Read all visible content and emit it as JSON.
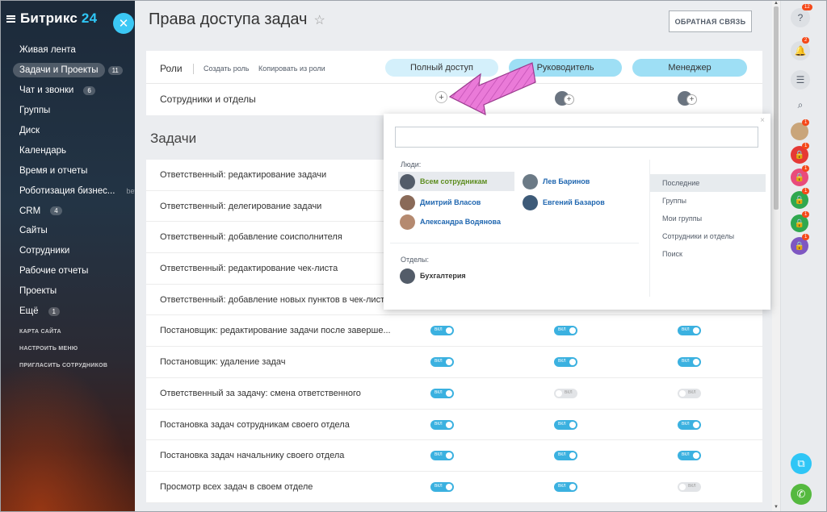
{
  "sidebar": {
    "logo_name": "Битрикс",
    "logo_num": "24",
    "items": [
      {
        "label": "Живая лента",
        "count": ""
      },
      {
        "label": "Задачи и Проекты",
        "count": "11"
      },
      {
        "label": "Чат и звонки",
        "count": "6"
      },
      {
        "label": "Группы",
        "count": ""
      },
      {
        "label": "Диск",
        "count": ""
      },
      {
        "label": "Календарь",
        "count": ""
      },
      {
        "label": "Время и отчеты",
        "count": ""
      },
      {
        "label": "Роботизация бизнес...",
        "count": "",
        "beta": "beta"
      },
      {
        "label": "CRM",
        "count": "4"
      },
      {
        "label": "Сайты",
        "count": ""
      },
      {
        "label": "Сотрудники",
        "count": ""
      },
      {
        "label": "Рабочие отчеты",
        "count": ""
      },
      {
        "label": "Проекты",
        "count": ""
      },
      {
        "label": "Ещё",
        "count": "1"
      }
    ],
    "links": [
      "КАРТА САЙТА",
      "НАСТРОИТЬ МЕНЮ",
      "ПРИГЛАСИТЬ СОТРУДНИКОВ"
    ]
  },
  "page": {
    "title": "Права доступа задач",
    "feedback": "ОБРАТНАЯ СВЯЗЬ"
  },
  "roles": {
    "label": "Роли",
    "create": "Создать роль",
    "copy": "Копировать из роли",
    "role_names": [
      "Полный доступ",
      "Руководитель",
      "Менеджер"
    ],
    "staff_label": "Сотрудники и отделы",
    "plus": "+"
  },
  "tasks": {
    "section_title": "Задачи",
    "toggle_text": "ВКЛ",
    "rows": [
      {
        "label": "Ответственный: редактирование задачи",
        "states": [
          true,
          true,
          true
        ]
      },
      {
        "label": "Ответственный: делегирование задачи",
        "states": [
          true,
          true,
          true
        ]
      },
      {
        "label": "Ответственный: добавление соисполнителя",
        "states": [
          true,
          true,
          true
        ]
      },
      {
        "label": "Ответственный: редактирование чек-листа",
        "states": [
          true,
          true,
          true
        ]
      },
      {
        "label": "Ответственный: добавление новых пунктов в чек-листы",
        "states": [
          true,
          true,
          true
        ]
      },
      {
        "label": "Постановщик: редактирование задачи после заверше...",
        "states": [
          true,
          true,
          true
        ]
      },
      {
        "label": "Постановщик: удаление задач",
        "states": [
          true,
          true,
          true
        ]
      },
      {
        "label": "Ответственный за задачу: смена ответственного",
        "states": [
          true,
          false,
          false
        ]
      },
      {
        "label": "Постановка задач сотрудникам своего отдела",
        "states": [
          true,
          true,
          true
        ]
      },
      {
        "label": "Постановка задач начальнику своего отдела",
        "states": [
          true,
          true,
          true
        ]
      },
      {
        "label": "Просмотр всех задач в своем отделе",
        "states": [
          true,
          true,
          false
        ]
      }
    ]
  },
  "popup": {
    "close": "×",
    "people_title": "Люди:",
    "people": [
      {
        "name": "Всем сотрудникам",
        "selected": true
      },
      {
        "name": "Лев Баринов",
        "selected": false
      },
      {
        "name": "Дмитрий Власов",
        "selected": false
      },
      {
        "name": "Евгений Базаров",
        "selected": false
      },
      {
        "name": "Александра Водянова",
        "selected": false
      }
    ],
    "departments_title": "Отделы:",
    "departments": [
      {
        "name": "Бухгалтерия"
      }
    ],
    "tabs": [
      "Последние",
      "Группы",
      "Мои группы",
      "Сотрудники и отделы",
      "Поиск"
    ]
  },
  "rightbar": {
    "help_count": "12",
    "bell_count": "2",
    "chat_counts": [
      "1",
      "1",
      "1",
      "1",
      "1",
      "1"
    ],
    "colors": {
      "red": "#e53935",
      "pink": "#e94b7b",
      "green": "#2fa84f",
      "purple": "#7e57c2",
      "teal": "#2fc6f6",
      "call": "#55b93f"
    }
  }
}
